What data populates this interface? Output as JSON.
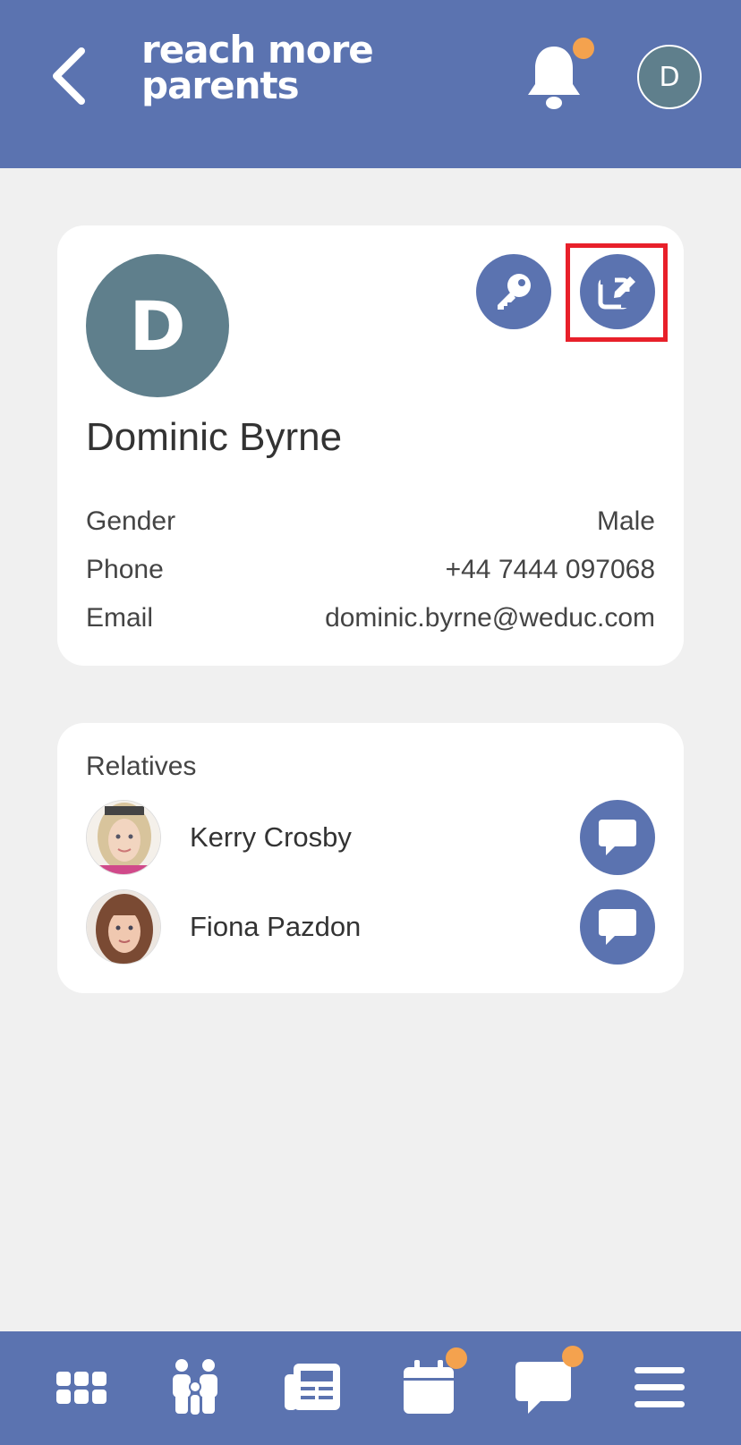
{
  "header": {
    "logo_line1": "reach more",
    "logo_line2": "parents",
    "avatar_initial": "D",
    "icons": [
      "back-chevron-icon",
      "bell-icon"
    ]
  },
  "profile": {
    "initial": "D",
    "name": "Dominic Byrne",
    "fields": [
      {
        "label": "Gender",
        "value": "Male"
      },
      {
        "label": "Phone",
        "value": "+44 7444 097068"
      },
      {
        "label": "Email",
        "value": "dominic.byrne@weduc.com"
      }
    ],
    "actions": [
      "key-icon",
      "edit-icon"
    ]
  },
  "relatives": {
    "label": "Relatives",
    "items": [
      {
        "name": "Kerry Crosby"
      },
      {
        "name": "Fiona Pazdon"
      }
    ]
  },
  "bottom_nav": {
    "items": [
      "apps-grid-icon",
      "family-icon",
      "newspaper-icon",
      "calendar-icon",
      "chat-icon",
      "menu-icon"
    ]
  },
  "colors": {
    "brand": "#5b73b0",
    "notification_dot": "#f4a24e",
    "avatar": "#5f7f8c",
    "highlight": "#e8202a",
    "background": "#f0f0f0"
  }
}
